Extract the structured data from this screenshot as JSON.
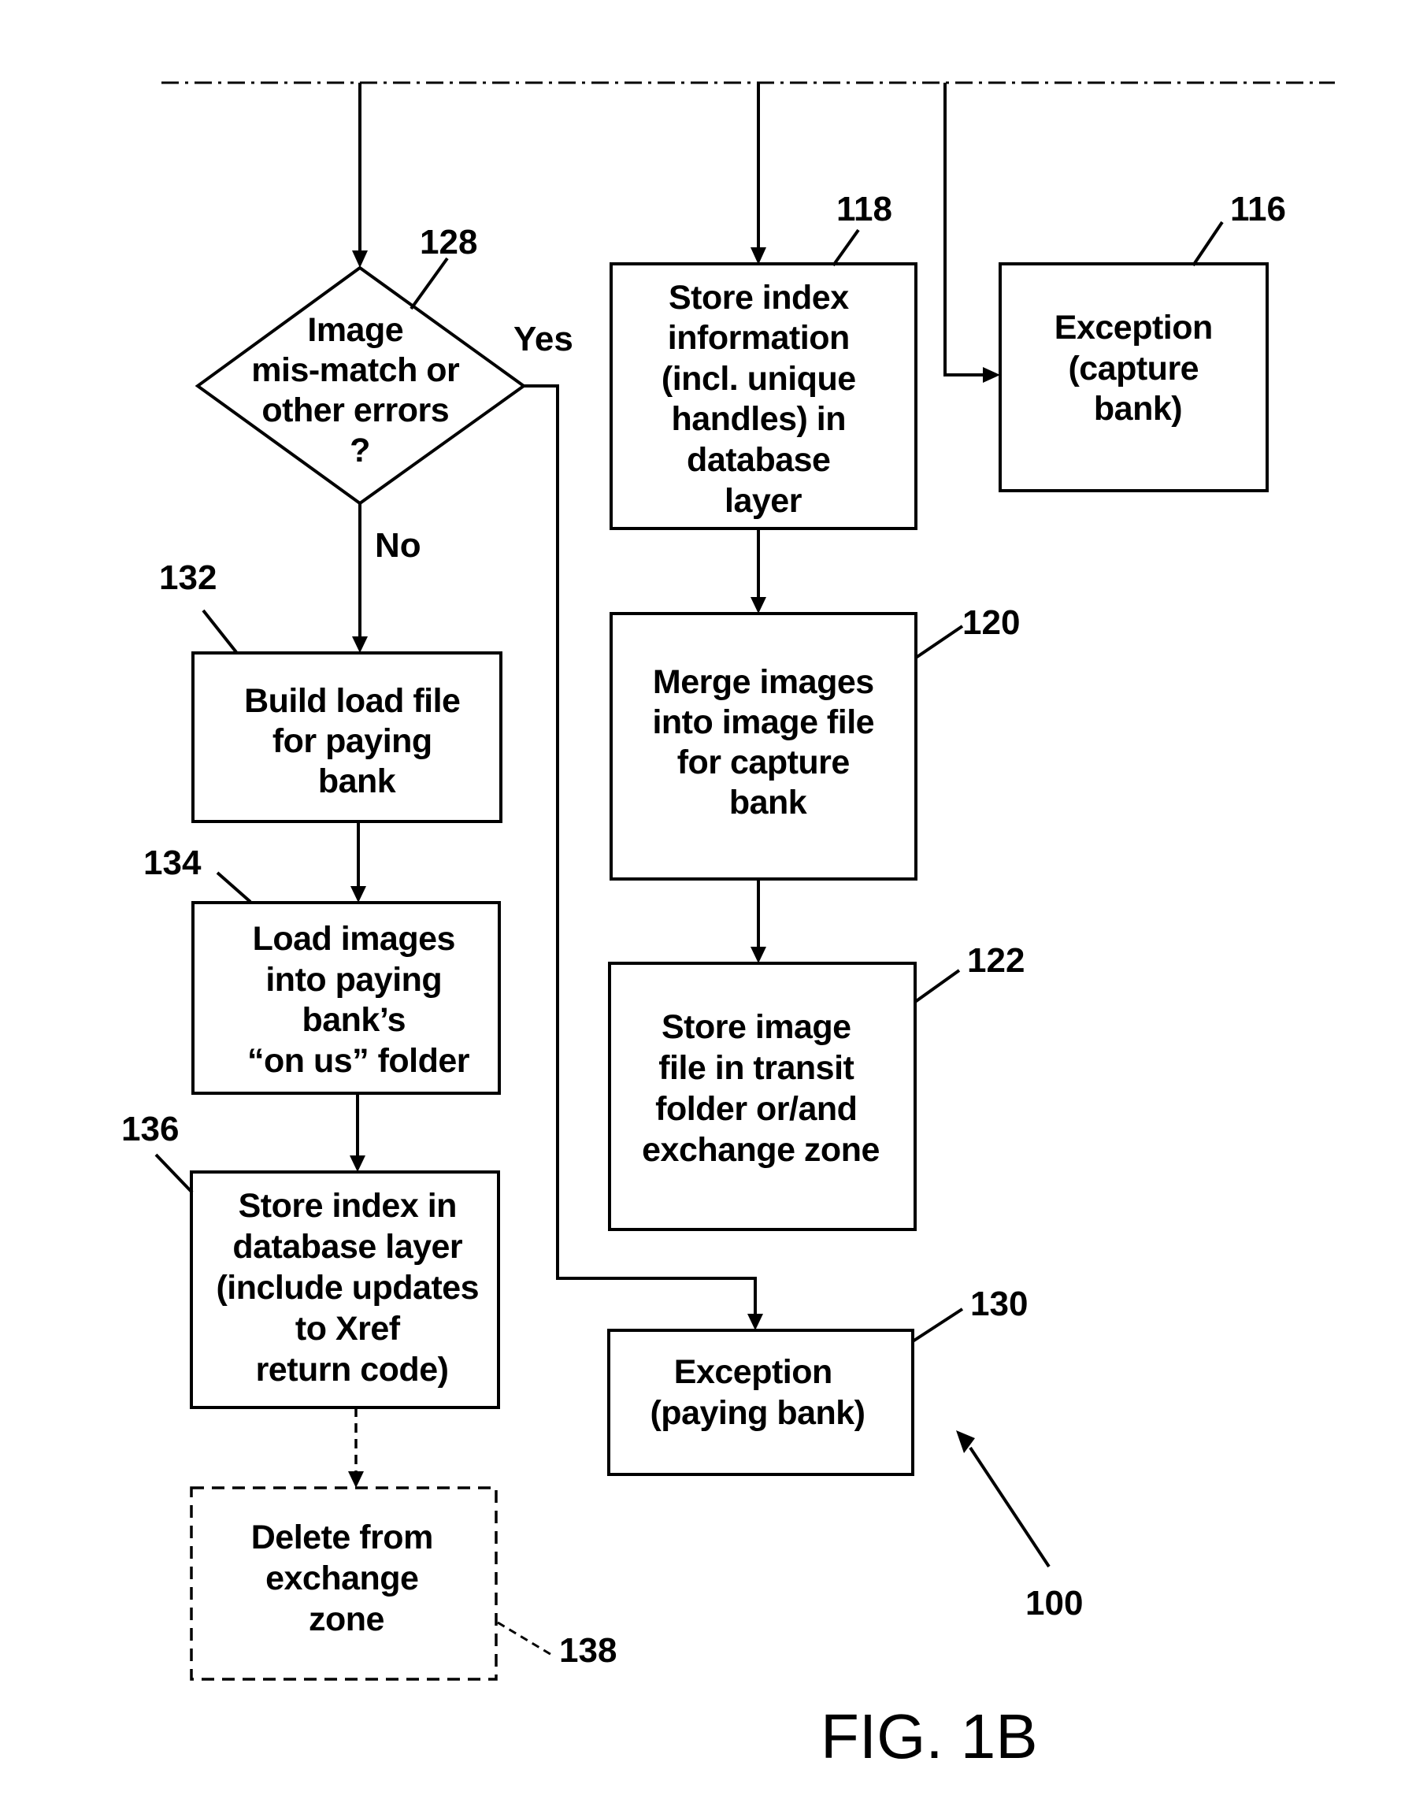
{
  "figure": {
    "label": "FIG. 1B",
    "reference": "100"
  },
  "nodes": {
    "n128": {
      "ref": "128",
      "type": "decision",
      "lines": [
        "Image",
        "mis-match or",
        "other errors",
        "?"
      ],
      "yes_label": "Yes",
      "no_label": "No"
    },
    "n118": {
      "ref": "118",
      "type": "process",
      "lines": [
        "Store index",
        "information",
        "(incl. unique",
        "handles) in",
        "database",
        "layer"
      ]
    },
    "n116": {
      "ref": "116",
      "type": "process",
      "lines": [
        "Exception",
        "(capture",
        "bank)"
      ]
    },
    "n120": {
      "ref": "120",
      "type": "process",
      "lines": [
        "Merge images",
        "into image file",
        "for capture",
        "bank"
      ]
    },
    "n122": {
      "ref": "122",
      "type": "process",
      "lines": [
        "Store image",
        "file in transit",
        "folder or/and",
        "exchange zone"
      ]
    },
    "n130": {
      "ref": "130",
      "type": "process",
      "lines": [
        "Exception",
        "(paying bank)"
      ]
    },
    "n132": {
      "ref": "132",
      "type": "process",
      "lines": [
        "Build load file",
        "for paying",
        "bank"
      ]
    },
    "n134": {
      "ref": "134",
      "type": "process",
      "lines": [
        "Load images",
        "into paying",
        "bank’s",
        "“on us” folder"
      ]
    },
    "n136": {
      "ref": "136",
      "type": "process",
      "lines": [
        "Store index in",
        "database layer",
        "(include updates",
        "to Xref",
        "return code)"
      ]
    },
    "n138": {
      "ref": "138",
      "type": "optional-process",
      "lines": [
        "Delete from",
        "exchange",
        "zone"
      ]
    }
  },
  "edges": [
    {
      "from": "continuation",
      "to": "n128"
    },
    {
      "from": "continuation",
      "to": "n118"
    },
    {
      "from": "continuation",
      "to": "n116"
    },
    {
      "from": "n128",
      "to": "n132",
      "label": "No"
    },
    {
      "from": "n128",
      "to": "n130",
      "label": "Yes"
    },
    {
      "from": "n118",
      "to": "n120"
    },
    {
      "from": "n120",
      "to": "n122"
    },
    {
      "from": "n132",
      "to": "n134"
    },
    {
      "from": "n134",
      "to": "n136"
    },
    {
      "from": "n136",
      "to": "n138",
      "style": "dashed"
    }
  ]
}
